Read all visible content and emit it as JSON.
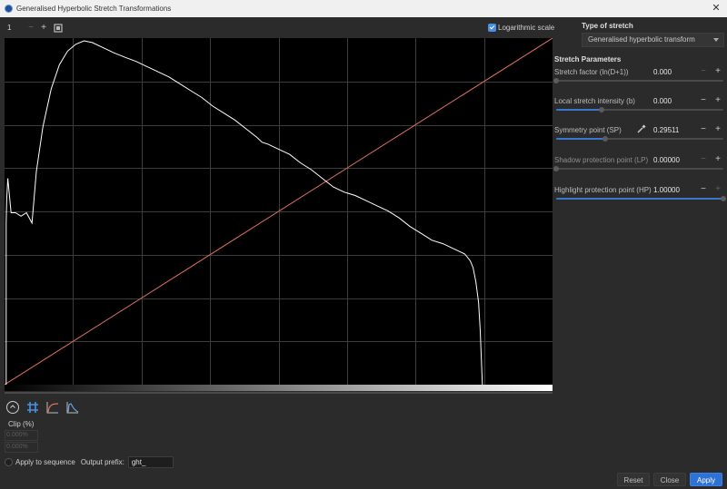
{
  "window": {
    "title": "Generalised Hyperbolic Stretch Transformations",
    "close_glyph": "✕"
  },
  "toolbar": {
    "zoom_value": "1",
    "minus": "−",
    "plus": "+",
    "log_scale_label": "Logarithmic scale",
    "log_scale_checked": true
  },
  "histogram": {
    "background": "#000000",
    "grid_color": "#3c3c3c",
    "curve_color": "#ffffff",
    "identity_line_color": "#e07060",
    "curve": [
      [
        0.003,
        0.0
      ],
      [
        0.003,
        0.47
      ],
      [
        0.004,
        0.54
      ],
      [
        0.006,
        0.6
      ],
      [
        0.012,
        0.5
      ],
      [
        0.02,
        0.5
      ],
      [
        0.03,
        0.49
      ],
      [
        0.04,
        0.5
      ],
      [
        0.05,
        0.47
      ],
      [
        0.058,
        0.62
      ],
      [
        0.07,
        0.75
      ],
      [
        0.085,
        0.86
      ],
      [
        0.1,
        0.93
      ],
      [
        0.115,
        0.97
      ],
      [
        0.13,
        0.99
      ],
      [
        0.145,
        1.0
      ],
      [
        0.16,
        0.995
      ],
      [
        0.18,
        0.98
      ],
      [
        0.2,
        0.965
      ],
      [
        0.22,
        0.952
      ],
      [
        0.24,
        0.94
      ],
      [
        0.26,
        0.925
      ],
      [
        0.28,
        0.91
      ],
      [
        0.3,
        0.895
      ],
      [
        0.32,
        0.875
      ],
      [
        0.34,
        0.855
      ],
      [
        0.36,
        0.835
      ],
      [
        0.38,
        0.81
      ],
      [
        0.4,
        0.79
      ],
      [
        0.42,
        0.77
      ],
      [
        0.44,
        0.745
      ],
      [
        0.46,
        0.72
      ],
      [
        0.47,
        0.705
      ],
      [
        0.48,
        0.7
      ],
      [
        0.5,
        0.685
      ],
      [
        0.52,
        0.67
      ],
      [
        0.54,
        0.645
      ],
      [
        0.56,
        0.625
      ],
      [
        0.58,
        0.6
      ],
      [
        0.6,
        0.575
      ],
      [
        0.62,
        0.56
      ],
      [
        0.64,
        0.55
      ],
      [
        0.66,
        0.535
      ],
      [
        0.68,
        0.52
      ],
      [
        0.7,
        0.505
      ],
      [
        0.72,
        0.485
      ],
      [
        0.74,
        0.46
      ],
      [
        0.76,
        0.44
      ],
      [
        0.78,
        0.42
      ],
      [
        0.8,
        0.41
      ],
      [
        0.82,
        0.395
      ],
      [
        0.84,
        0.38
      ],
      [
        0.85,
        0.36
      ],
      [
        0.855,
        0.34
      ],
      [
        0.86,
        0.3
      ],
      [
        0.865,
        0.24
      ],
      [
        0.868,
        0.16
      ],
      [
        0.87,
        0.08
      ],
      [
        0.872,
        0.0
      ]
    ]
  },
  "tools": {
    "reset_view_icon": "reset-view-icon",
    "grid_icon": "grid-icon",
    "curve_icon": "curve-icon",
    "histogram_icon": "histogram-icon",
    "accent": "#4a90e2"
  },
  "clip": {
    "label": "Clip (%)",
    "low": "0.000%",
    "high": "0.000%"
  },
  "sequence": {
    "apply_label": "Apply to sequence",
    "prefix_label": "Output prefix:",
    "prefix_value": "ght_"
  },
  "panel": {
    "type_title": "Type of stretch",
    "type_value": "Generalised hyperbolic transform",
    "params_title": "Stretch Parameters",
    "params": [
      {
        "label": "Stretch factor (ln(D+1))",
        "value": "0.000",
        "level": 0.0,
        "fill": false,
        "minus_enabled": false,
        "plus_enabled": true
      },
      {
        "label": "Local stretch intensity (b)",
        "value": "0.000",
        "level": 0.27,
        "fill": true,
        "minus_enabled": true,
        "plus_enabled": true
      },
      {
        "label": "Symmetry point (SP)",
        "value": "0.29511",
        "level": 0.295,
        "fill": true,
        "minus_enabled": true,
        "plus_enabled": true,
        "picker": "eyedropper-icon"
      },
      {
        "label": "Shadow protection point (LP)",
        "value": "0.00000",
        "level": 0.0,
        "fill": false,
        "minus_enabled": false,
        "plus_enabled": true
      },
      {
        "label": "Highlight protection point (HP)",
        "value": "1.00000",
        "level": 1.0,
        "fill": true,
        "minus_enabled": true,
        "plus_enabled": false
      }
    ]
  },
  "buttons": {
    "reset": "Reset",
    "close": "Close",
    "apply": "Apply"
  }
}
